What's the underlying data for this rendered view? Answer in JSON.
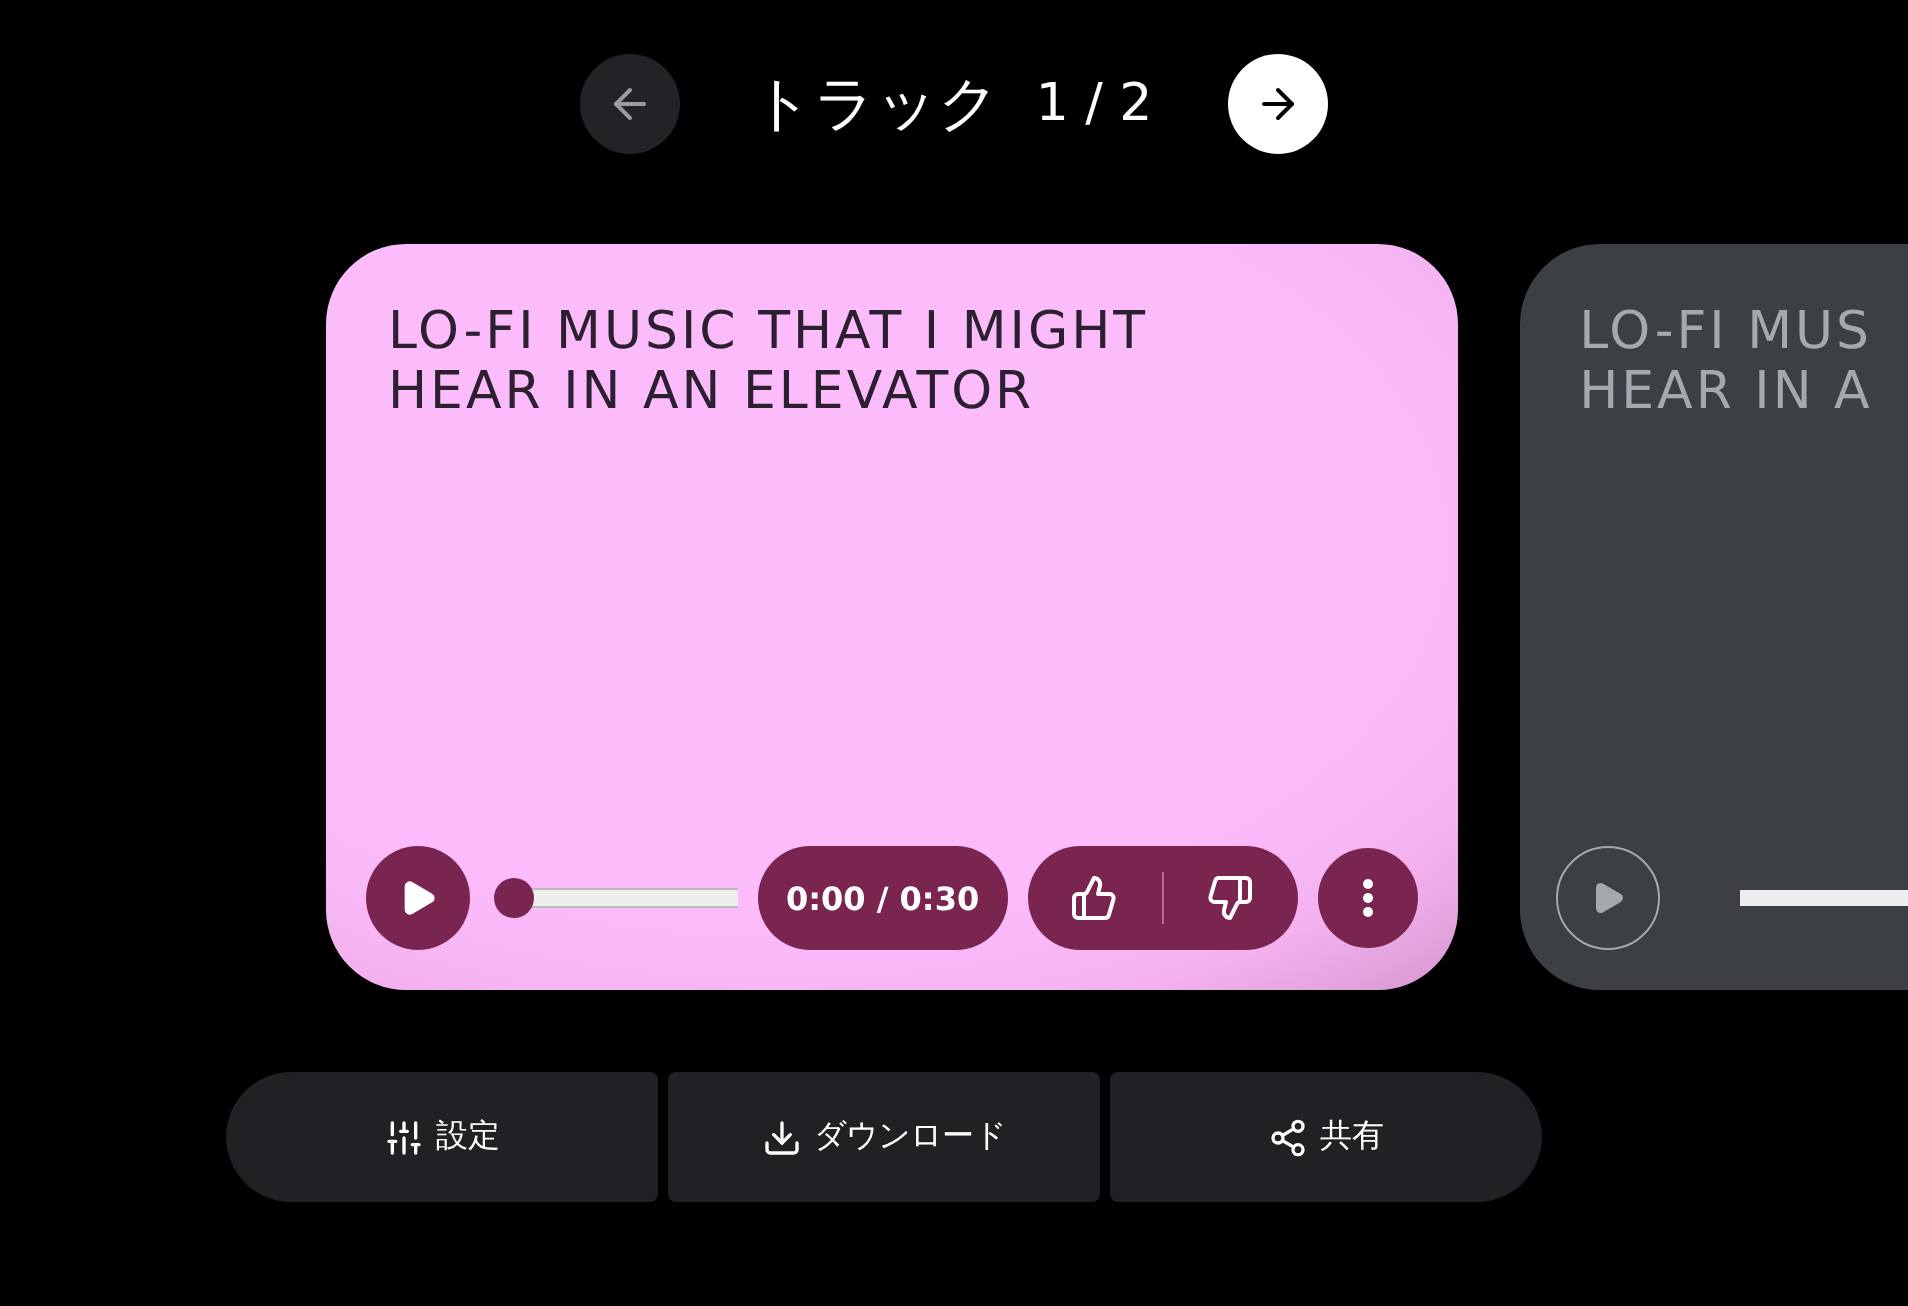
{
  "header": {
    "title": "トラック",
    "counter": "1 / 2",
    "prev_enabled": false,
    "next_enabled": true
  },
  "cards": [
    {
      "title": "LO-FI MUSIC THAT I MIGHT HEAR IN AN ELEVATOR",
      "active": true,
      "level": 0,
      "time": "0:00 / 0:30"
    },
    {
      "title": "LO-FI MUS\nHEAR IN A",
      "active": false
    }
  ],
  "actions": [
    {
      "kind": "settings",
      "label": "設定"
    },
    {
      "kind": "download",
      "label": "ダウンロード"
    },
    {
      "kind": "share",
      "label": "共有"
    }
  ]
}
